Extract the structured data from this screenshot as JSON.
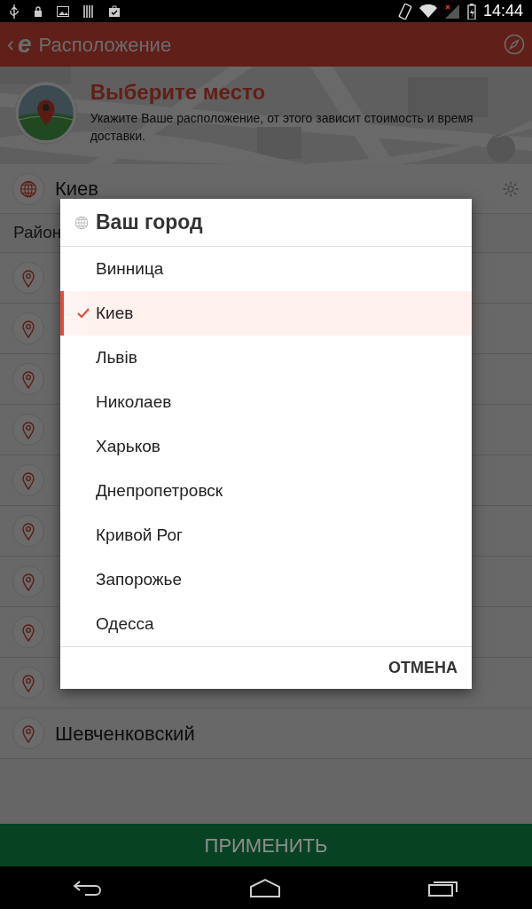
{
  "status_bar": {
    "time": "14:44"
  },
  "app_bar": {
    "back": "‹",
    "logo": "e",
    "title": "Расположение"
  },
  "header": {
    "kind": "picture",
    "title": "Выберите место",
    "text": "Укажите Ваше расположение, от этого зависит стоимость и время доставки."
  },
  "city_row": {
    "name": "Киев"
  },
  "districts_label": "Район",
  "district_rows": [
    {
      "kind": "covered"
    },
    {
      "kind": "covered"
    },
    {
      "kind": "covered"
    },
    {
      "kind": "covered"
    },
    {
      "kind": "covered"
    },
    {
      "kind": "covered"
    },
    {
      "kind": "covered"
    },
    {
      "kind": "covered"
    },
    {
      "kind": "covered"
    },
    {
      "kind": "named",
      "name": "Шевченковский"
    }
  ],
  "apply_button": {
    "label": "ПРИМЕНИТЬ"
  },
  "dialog": {
    "title": "Ваш город",
    "items": [
      {
        "label": "Винница",
        "selected": false
      },
      {
        "label": "Киев",
        "selected": true
      },
      {
        "label": "Львів",
        "selected": false
      },
      {
        "label": "Николаев",
        "selected": false
      },
      {
        "label": "Харьков",
        "selected": false
      },
      {
        "label": "Днепропетровск",
        "selected": false
      },
      {
        "label": "Кривой Рог",
        "selected": false
      },
      {
        "label": "Запорожье",
        "selected": false
      },
      {
        "label": "Одесса",
        "selected": false
      }
    ],
    "cancel": "ОТМЕНА"
  }
}
